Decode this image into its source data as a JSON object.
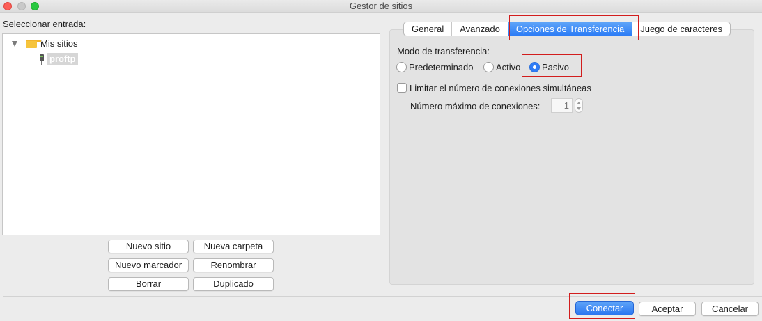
{
  "window": {
    "title": "Gestor de sitios"
  },
  "left": {
    "label": "Seleccionar entrada:",
    "tree": {
      "root": "Mis sitios",
      "child": "proftp"
    },
    "buttons": {
      "new_site": "Nuevo sitio",
      "new_folder": "Nueva carpeta",
      "new_bookmark": "Nuevo marcador",
      "rename": "Renombrar",
      "delete": "Borrar",
      "duplicate": "Duplicado"
    }
  },
  "tabs": [
    {
      "label": "General"
    },
    {
      "label": "Avanzado"
    },
    {
      "label": "Opciones de Transferencia"
    },
    {
      "label": "Juego de caracteres"
    }
  ],
  "transfer": {
    "mode_label": "Modo de transferencia:",
    "options": [
      "Predeterminado",
      "Activo",
      "Pasivo"
    ],
    "selected": "Pasivo",
    "limit_label": "Limitar el número de conexiones simultáneas",
    "limit_checked": false,
    "max_label": "Número máximo de conexiones:",
    "max_value": "1"
  },
  "footer": {
    "connect": "Conectar",
    "accept": "Aceptar",
    "cancel": "Cancelar"
  },
  "colors": {
    "accent": "#2f7cf6",
    "highlight_box": "#d21d1d"
  }
}
